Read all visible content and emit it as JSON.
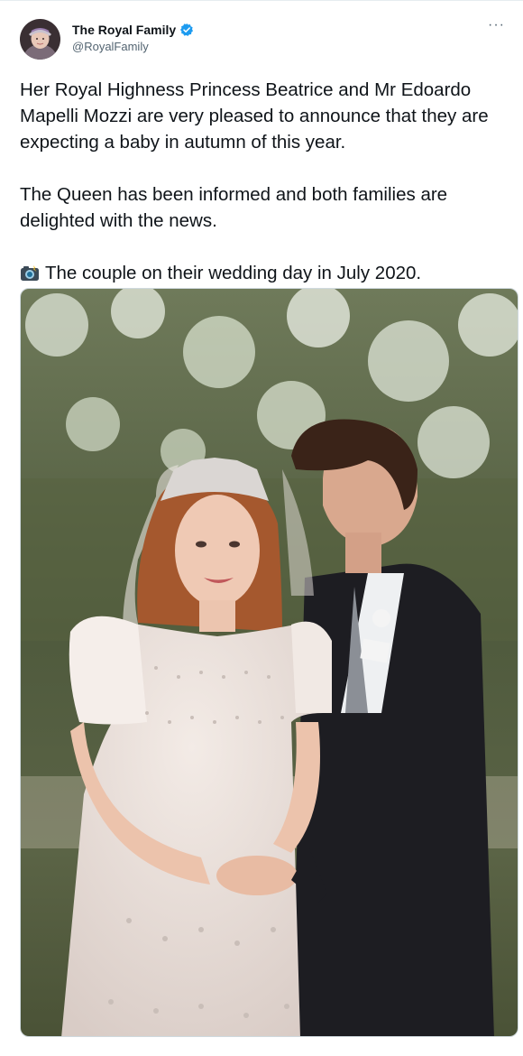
{
  "tweet": {
    "author": {
      "display_name": "The Royal Family",
      "handle": "@RoyalFamily",
      "verified": true,
      "avatar_icon": "queen-portrait-avatar"
    },
    "more_icon": "ellipsis-icon",
    "paragraphs": [
      "Her Royal Highness Princess Beatrice and Mr Edoardo Mapelli Mozzi are very pleased to announce that they are expecting a baby in autumn of this year.",
      "The Queen has been informed and both families are delighted with the news."
    ],
    "caption": {
      "icon": "camera-flash-emoji",
      "text": "The couple on their wedding day in July 2020."
    },
    "media": {
      "type": "photo"
    }
  },
  "colors": {
    "text": "#0f1419",
    "secondary": "#536471",
    "verified_blue": "#1d9bf0",
    "border": "#cfd9de"
  }
}
